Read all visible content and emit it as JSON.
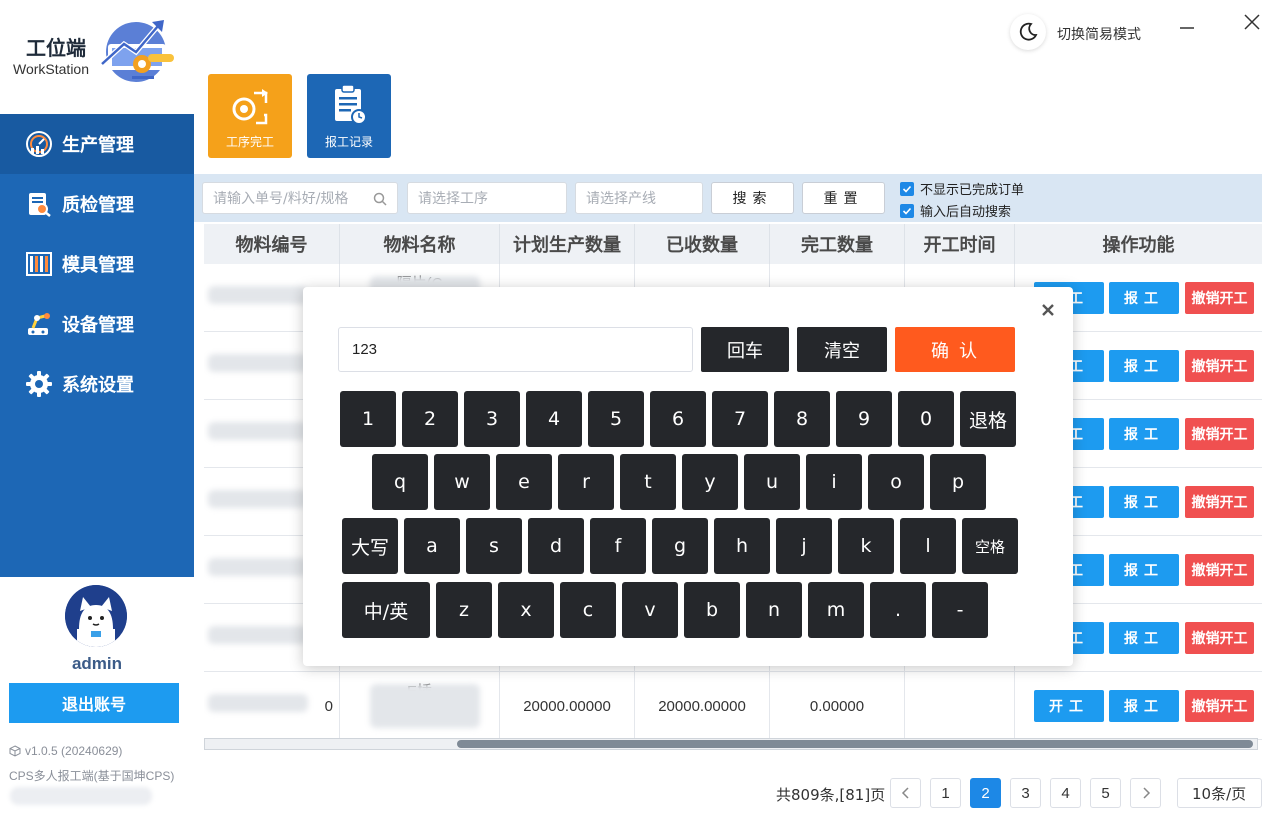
{
  "app": {
    "title": "工位端",
    "subtitle": "WorkStation",
    "mode_label": "切换简易模式"
  },
  "sidebar": {
    "items": [
      {
        "label": "生产管理",
        "icon": "dashboard-gauge-icon"
      },
      {
        "label": "质检管理",
        "icon": "inspection-document-icon"
      },
      {
        "label": "模具管理",
        "icon": "mold-rack-icon"
      },
      {
        "label": "设备管理",
        "icon": "equipment-robot-icon"
      },
      {
        "label": "系统设置",
        "icon": "gear-icon"
      }
    ],
    "active_index": 0
  },
  "user": {
    "name": "admin",
    "logout_label": "退出账号",
    "version": "v1.0.5 (20240629)",
    "product": "CPS多人报工端(基于国坤CPS)"
  },
  "toolbar": {
    "process_complete": "工序完工",
    "report_records": "报工记录"
  },
  "filters": {
    "order_placeholder": "请输入单号/料好/规格",
    "process_placeholder": "请选择工序",
    "line_placeholder": "请选择产线",
    "search_label": "搜索",
    "reset_label": "重置",
    "hide_completed_label": "不显示已完成订单",
    "auto_search_label": "输入后自动搜索"
  },
  "table": {
    "columns": [
      "物料编号",
      "物料名称",
      "计划生产数量",
      "已收数量",
      "完工数量",
      "开工时间",
      "操作功能"
    ],
    "rows": [
      {
        "code": "",
        "name": "隔片(C",
        "plan": "",
        "received": "",
        "done": "",
        "start": ""
      },
      {
        "code": "-0",
        "name": "",
        "plan": "",
        "received": "",
        "done": "",
        "start": ""
      },
      {
        "code": "N-0",
        "name": "",
        "plan": "",
        "received": "",
        "done": "",
        "start": ""
      },
      {
        "code": "N-0",
        "name": "",
        "plan": "",
        "received": "",
        "done": "",
        "start": ""
      },
      {
        "code": "3-0",
        "name": "",
        "plan": "",
        "received": "",
        "done": "",
        "start": ""
      },
      {
        "code": "08-0",
        "name": "",
        "plan": "",
        "received": "",
        "done": "",
        "start": ""
      },
      {
        "code": "0",
        "name": "E插",
        "plan": "20000.00000",
        "received": "20000.00000",
        "done": "0.00000",
        "start": ""
      }
    ],
    "actions": {
      "start": "开工",
      "report": "报工",
      "cancel": "撤销开工"
    }
  },
  "pagination": {
    "summary": "共809条,[81]页",
    "pages": [
      "1",
      "2",
      "3",
      "4",
      "5"
    ],
    "current": "2",
    "page_size": "10条/页"
  },
  "keyboard": {
    "input_value": "123",
    "enter_label": "回车",
    "clear_label": "清空",
    "confirm_label": "确认",
    "row1": [
      "1",
      "2",
      "3",
      "4",
      "5",
      "6",
      "7",
      "8",
      "9",
      "0",
      "退格"
    ],
    "row2": [
      "q",
      "w",
      "e",
      "r",
      "t",
      "y",
      "u",
      "i",
      "o",
      "p"
    ],
    "row3": [
      "大写",
      "a",
      "s",
      "d",
      "f",
      "g",
      "h",
      "j",
      "k",
      "l",
      "空格"
    ],
    "row4": [
      "中/英",
      "z",
      "x",
      "c",
      "v",
      "b",
      "n",
      "m",
      ".",
      "-"
    ]
  },
  "colors": {
    "sidebar_blue": "#1d67b5",
    "accent_blue": "#1d9bf0",
    "orange": "#f5a11a",
    "confirm_orange": "#ff5a1e",
    "cancel_red": "#f05050",
    "key_dark": "#25272b"
  }
}
